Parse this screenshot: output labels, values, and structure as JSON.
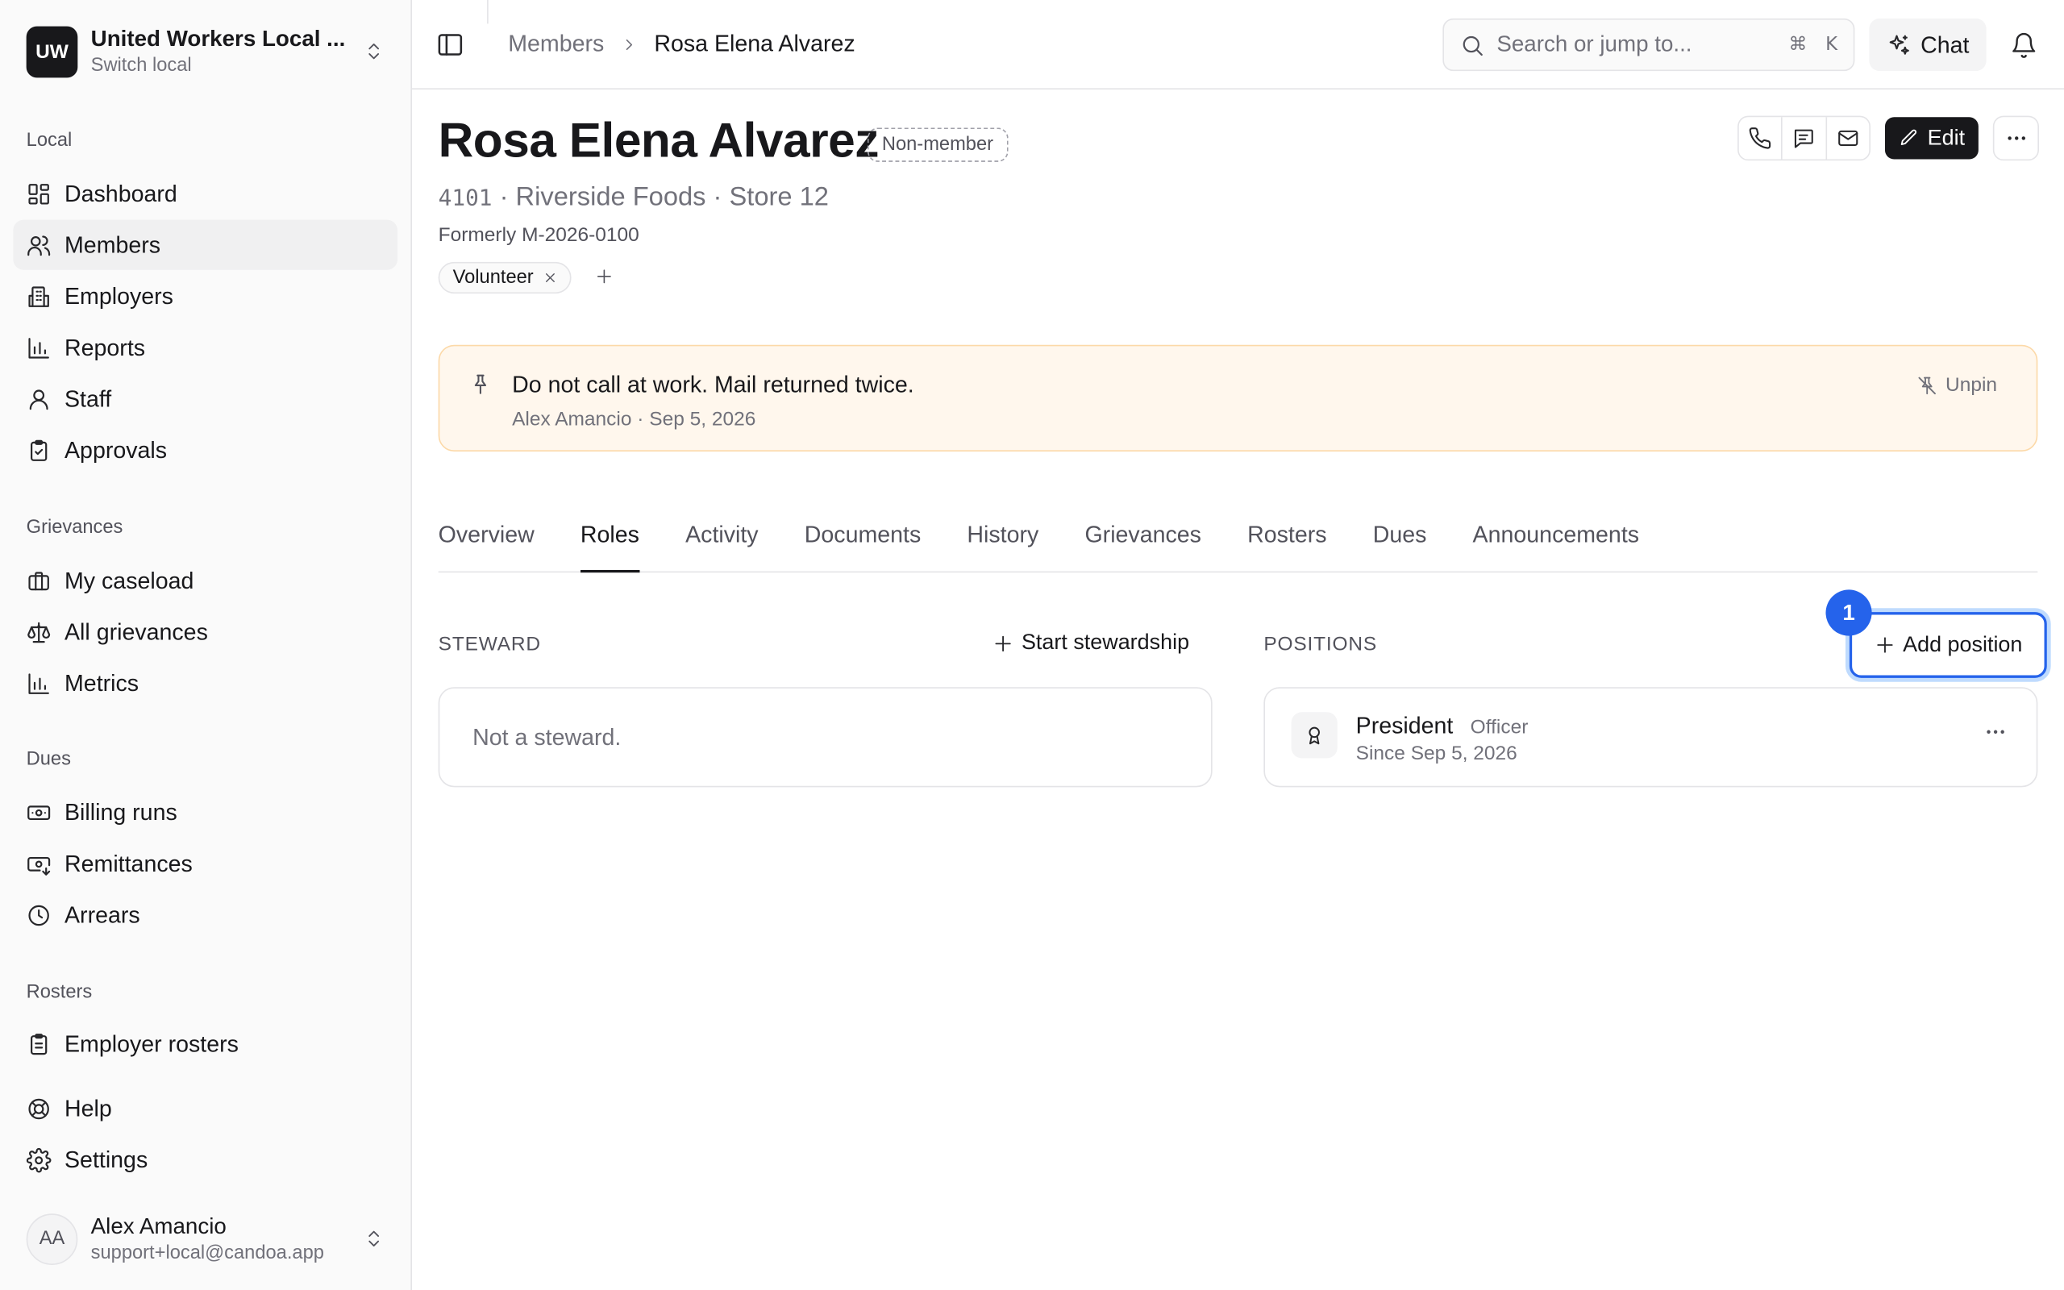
{
  "local": {
    "logo": "UW",
    "name": "United Workers Local ...",
    "sub": "Switch local"
  },
  "nav": {
    "local_label": "Local",
    "local_items": [
      "Dashboard",
      "Members",
      "Employers",
      "Reports",
      "Staff",
      "Approvals"
    ],
    "grievances_label": "Grievances",
    "grievance_items": [
      "My caseload",
      "All grievances",
      "Metrics"
    ],
    "dues_label": "Dues",
    "dues_items": [
      "Billing runs",
      "Remittances",
      "Arrears"
    ],
    "rosters_label": "Rosters",
    "roster_items": [
      "Employer rosters"
    ],
    "footer_items": [
      "Help",
      "Settings"
    ]
  },
  "user": {
    "initials": "AA",
    "name": "Alex Amancio",
    "email": "support+local@candoa.app"
  },
  "topbar": {
    "breadcrumb_parent": "Members",
    "breadcrumb_current": "Rosa Elena Alvarez",
    "search_placeholder": "Search or jump to...",
    "kbd_cmd": "⌘",
    "kbd_key": "K",
    "chat_label": "Chat"
  },
  "person": {
    "name": "Rosa Elena Alvarez",
    "status_badge": "Non-member",
    "number": "4101",
    "employer_line": " · Riverside Foods · Store 12",
    "formerly": "Formerly M-2026-0100",
    "tag": "Volunteer",
    "edit_label": "Edit"
  },
  "note": {
    "text": "Do not call at work. Mail returned twice.",
    "meta": "Alex Amancio · Sep 5, 2026",
    "unpin_label": "Unpin"
  },
  "tabs": [
    "Overview",
    "Roles",
    "Activity",
    "Documents",
    "History",
    "Grievances",
    "Rosters",
    "Dues",
    "Announcements"
  ],
  "active_tab": "Roles",
  "steward": {
    "label": "STEWARD",
    "action": "Start stewardship",
    "empty": "Not a steward."
  },
  "positions": {
    "label": "POSITIONS",
    "action": "Add position",
    "step_badge": "1",
    "items": [
      {
        "title": "President",
        "kind": "Officer",
        "since": "Since Sep 5, 2026"
      }
    ]
  },
  "colors": {
    "accent": "#2563eb",
    "note_bg": "#fff7ed",
    "note_border": "#fcd9a8",
    "primary": "#18181b"
  }
}
